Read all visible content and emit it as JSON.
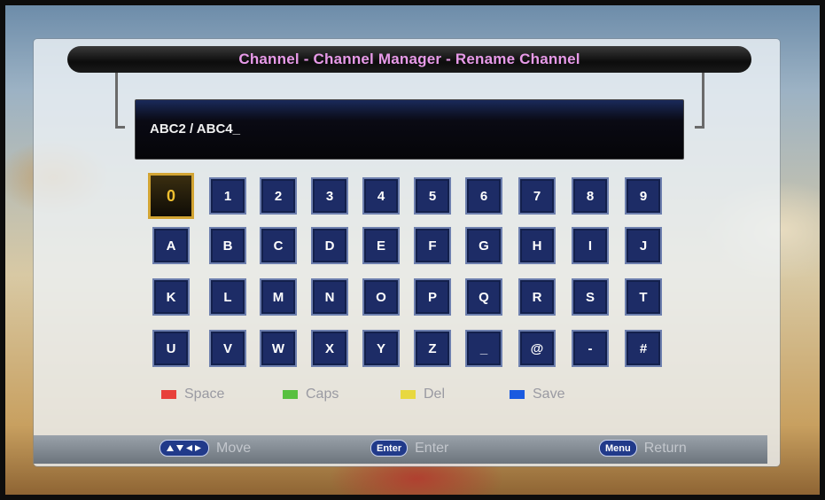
{
  "title": "Channel - Channel Manager - Rename Channel",
  "input": {
    "value": "ABC2 / ABC4_"
  },
  "keyboard": {
    "selected": "0",
    "rows": [
      [
        "0",
        "1",
        "2",
        "3",
        "4",
        "5",
        "6",
        "7",
        "8",
        "9"
      ],
      [
        "A",
        "B",
        "C",
        "D",
        "E",
        "F",
        "G",
        "H",
        "I",
        "J"
      ],
      [
        "K",
        "L",
        "M",
        "N",
        "O",
        "P",
        "Q",
        "R",
        "S",
        "T"
      ],
      [
        "U",
        "V",
        "W",
        "X",
        "Y",
        "Z",
        "_",
        "@",
        "-",
        "#"
      ]
    ]
  },
  "legend": [
    {
      "color": "#e8403a",
      "label": "Space",
      "icon": "red-button-icon"
    },
    {
      "color": "#58c040",
      "label": "Caps",
      "icon": "green-button-icon"
    },
    {
      "color": "#e8d840",
      "label": "Del",
      "icon": "yellow-button-icon"
    },
    {
      "color": "#1a5ae0",
      "label": "Save",
      "icon": "blue-button-icon"
    }
  ],
  "footer": {
    "move": {
      "key": "arrow-keys-icon",
      "label": "Move"
    },
    "enter": {
      "key": "Enter",
      "label": "Enter"
    },
    "return": {
      "key": "Menu",
      "label": "Return"
    }
  },
  "colors": {
    "title": "#e79ae8",
    "key_bg": "#1d2c66",
    "key_selected_border": "#d2a433",
    "key_selected_text": "#f0c030"
  }
}
